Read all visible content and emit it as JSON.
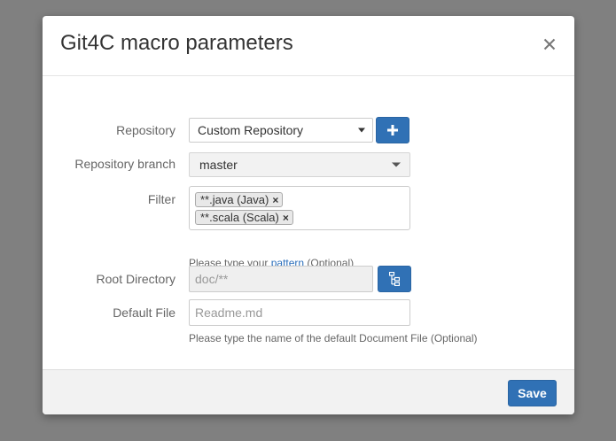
{
  "modal": {
    "title": "Git4C macro parameters",
    "close_icon": "close-icon"
  },
  "form": {
    "repository": {
      "label": "Repository",
      "selected": "Custom Repository",
      "add_icon": "plus-icon"
    },
    "branch": {
      "label": "Repository branch",
      "selected": "master"
    },
    "filter": {
      "label": "Filter",
      "tags": [
        "**.java (Java)",
        "**.scala (Scala)"
      ],
      "remove_glyph": "×",
      "help_prefix": "Please type your ",
      "help_link": "pattern",
      "help_suffix": " (Optional)"
    },
    "root_directory": {
      "label": "Root Directory",
      "placeholder": "doc/**",
      "tree_icon": "directory-tree-icon"
    },
    "default_file": {
      "label": "Default File",
      "placeholder": "Readme.md",
      "help": "Please type the name of the default Document File (Optional)"
    }
  },
  "footer": {
    "save_label": "Save"
  },
  "colors": {
    "backdrop": "#808080",
    "primary": "#3071b5",
    "link": "#2a6ebb"
  }
}
